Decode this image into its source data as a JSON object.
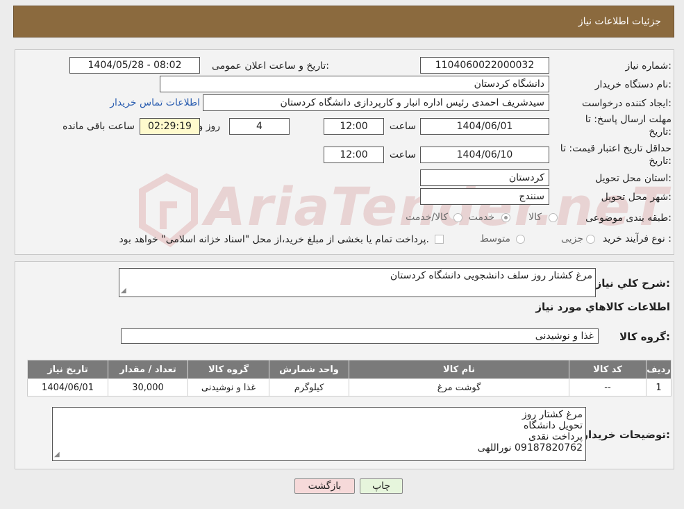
{
  "header": {
    "title": "جزئیات اطلاعات نیاز"
  },
  "watermark": {
    "text": "AriaTender.neT"
  },
  "details": {
    "need_number_label": "شماره نیاز:",
    "need_number": "1104060022000032",
    "announce_label": "تاریخ و ساعت اعلان عمومی:",
    "announce_value": "1404/05/28 - 08:02",
    "buyer_org_label": "نام دستگاه خریدار:",
    "buyer_org": "دانشگاه کردستان",
    "creator_label": "ایجاد کننده درخواست:",
    "creator": "سیدشریف احمدی رئیس اداره انبار و کارپردازی دانشگاه کردستان",
    "contact_link": "اطلاعات تماس خریدار",
    "deadline_label_1": "مهلت ارسال پاسخ: تا",
    "deadline_label_2": "تاریخ:",
    "deadline_date": "1404/06/01",
    "time_label": "ساعت",
    "deadline_time": "12:00",
    "days_value": "4",
    "days_label": "روز و",
    "remaining_time": "02:29:19",
    "remaining_label": "ساعت باقی مانده",
    "validity_label_1": "حداقل تاریخ اعتبار قیمت: تا",
    "validity_label_2": "تاریخ:",
    "validity_date": "1404/06/10",
    "validity_time": "12:00",
    "province_label": "استان محل تحویل:",
    "province": "کردستان",
    "city_label": "شهر محل تحویل:",
    "city": "سنندج",
    "category_label": "طبقه بندی موضوعی:",
    "category_options": [
      "کالا",
      "خدمت",
      "کالا/خدمت"
    ],
    "process_label": "نوع فرآیند خرید :",
    "process_options": [
      "جزیی",
      "متوسط"
    ],
    "process_note": "پرداخت تمام یا بخشی از مبلغ خرید،از محل \"اسناد خزانه اسلامی\" خواهد بود."
  },
  "need": {
    "summary_label": "شرح کلي نياز:",
    "summary": "مرغ کشتار روز سلف دانشجویی دانشگاه کردستان",
    "goods_info_title": "اطلاعات کالاهاي مورد نياز",
    "goods_group_label": "گروه کالا:",
    "goods_group": "غذا و نوشیدنی",
    "table": {
      "headers": [
        "ردیف",
        "کد کالا",
        "نام کالا",
        "واحد شمارش",
        "گروه کالا",
        "تعداد / مقدار",
        "تاریخ نیاز"
      ],
      "rows": [
        [
          "1",
          "--",
          "گوشت مرغ",
          "کیلوگرم",
          "غذا و نوشیدنی",
          "30,000",
          "1404/06/01"
        ]
      ]
    },
    "buyer_notes_label": "توضیحات خریدار:",
    "buyer_notes": [
      "مرغ کشتار روز",
      "تحویل دانشگاه",
      "پرداخت نقدی",
      "09187820762 نوراللهی"
    ]
  },
  "buttons": {
    "back": "بازگشت",
    "print": "چاپ"
  },
  "colors": {
    "header_bg": "#8b6a3e",
    "table_header_bg": "#7a7a7a",
    "back_button_bg": "#f6d9d9",
    "print_button_bg": "#e6f5dc"
  }
}
